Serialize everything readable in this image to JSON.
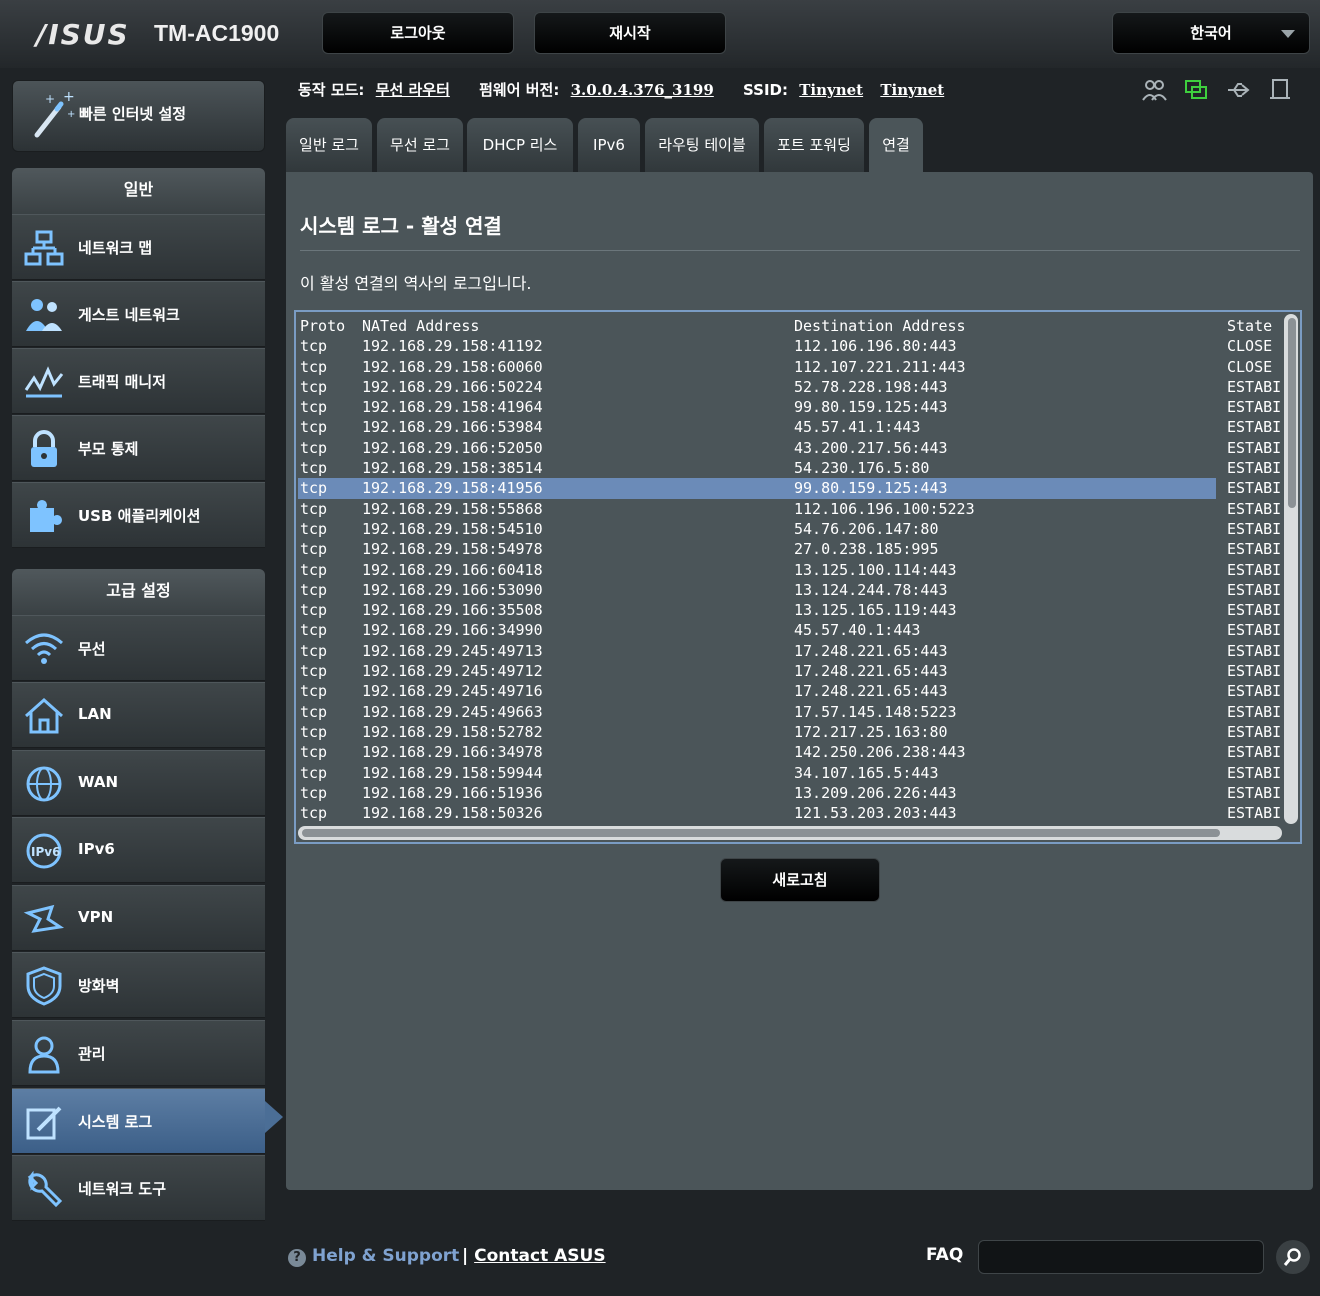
{
  "header": {
    "brand": "/ISUS",
    "model": "TM-AC1900",
    "logout_label": "로그아웃",
    "restart_label": "재시작",
    "language": "한국어"
  },
  "info": {
    "mode_label": "동작 모드:",
    "mode_value": "무선 라우터",
    "firmware_label": "펌웨어 버전:",
    "firmware_value": "3.0.0.4.376_3199",
    "ssid_label": "SSID:",
    "ssid_1": "Tinynet",
    "ssid_2": "Tinynet"
  },
  "sidebar": {
    "quick_setup": "빠른 인터넷 설정",
    "general_title": "일반",
    "general_items": [
      {
        "label": "네트워크 맵",
        "icon": "network-map-icon"
      },
      {
        "label": "게스트 네트워크",
        "icon": "guest-network-icon"
      },
      {
        "label": "트래픽 매니저",
        "icon": "traffic-manager-icon"
      },
      {
        "label": "부모 통제",
        "icon": "lock-icon"
      },
      {
        "label": "USB 애플리케이션",
        "icon": "puzzle-icon"
      }
    ],
    "advanced_title": "고급 설정",
    "advanced_items": [
      {
        "label": "무선",
        "icon": "wifi-icon"
      },
      {
        "label": "LAN",
        "icon": "home-icon"
      },
      {
        "label": "WAN",
        "icon": "globe-icon"
      },
      {
        "label": "IPv6",
        "icon": "ipv6-icon"
      },
      {
        "label": "VPN",
        "icon": "vpn-icon"
      },
      {
        "label": "방화벽",
        "icon": "shield-icon"
      },
      {
        "label": "관리",
        "icon": "admin-user-icon"
      },
      {
        "label": "시스템 로그",
        "icon": "system-log-icon"
      },
      {
        "label": "네트워크 도구",
        "icon": "network-tools-icon"
      }
    ]
  },
  "tabs": [
    "일반 로그",
    "무선 로그",
    "DHCP 리스",
    "IPv6",
    "라우팅 테이블",
    "포트 포워딩",
    "연결"
  ],
  "content": {
    "title": "시스템 로그 - 활성 연결",
    "description": "이 활성 연결의 역사의 로그입니다.",
    "columns": [
      "Proto",
      "NATed Address",
      "Destination Address",
      "State"
    ],
    "rows": [
      [
        "tcp",
        "192.168.29.158:41192",
        "112.106.196.80:443",
        "CLOSE"
      ],
      [
        "tcp",
        "192.168.29.158:60060",
        "112.107.221.211:443",
        "CLOSE"
      ],
      [
        "tcp",
        "192.168.29.166:50224",
        "52.78.228.198:443",
        "ESTABI"
      ],
      [
        "tcp",
        "192.168.29.158:41964",
        "99.80.159.125:443",
        "ESTABI"
      ],
      [
        "tcp",
        "192.168.29.166:53984",
        "45.57.41.1:443",
        "ESTABI"
      ],
      [
        "tcp",
        "192.168.29.166:52050",
        "43.200.217.56:443",
        "ESTABI"
      ],
      [
        "tcp",
        "192.168.29.158:38514",
        "54.230.176.5:80",
        "ESTABI"
      ],
      [
        "tcp",
        "192.168.29.158:41956",
        "99.80.159.125:443",
        "ESTABI"
      ],
      [
        "tcp",
        "192.168.29.158:55868",
        "112.106.196.100:5223",
        "ESTABI"
      ],
      [
        "tcp",
        "192.168.29.158:54510",
        "54.76.206.147:80",
        "ESTABI"
      ],
      [
        "tcp",
        "192.168.29.158:54978",
        "27.0.238.185:995",
        "ESTABI"
      ],
      [
        "tcp",
        "192.168.29.166:60418",
        "13.125.100.114:443",
        "ESTABI"
      ],
      [
        "tcp",
        "192.168.29.166:53090",
        "13.124.244.78:443",
        "ESTABI"
      ],
      [
        "tcp",
        "192.168.29.166:35508",
        "13.125.165.119:443",
        "ESTABI"
      ],
      [
        "tcp",
        "192.168.29.166:34990",
        "45.57.40.1:443",
        "ESTABI"
      ],
      [
        "tcp",
        "192.168.29.245:49713",
        "17.248.221.65:443",
        "ESTABI"
      ],
      [
        "tcp",
        "192.168.29.245:49712",
        "17.248.221.65:443",
        "ESTABI"
      ],
      [
        "tcp",
        "192.168.29.245:49716",
        "17.248.221.65:443",
        "ESTABI"
      ],
      [
        "tcp",
        "192.168.29.245:49663",
        "17.57.145.148:5223",
        "ESTABI"
      ],
      [
        "tcp",
        "192.168.29.158:52782",
        "172.217.25.163:80",
        "ESTABI"
      ],
      [
        "tcp",
        "192.168.29.166:34978",
        "142.250.206.238:443",
        "ESTABI"
      ],
      [
        "tcp",
        "192.168.29.158:59944",
        "34.107.165.5:443",
        "ESTABI"
      ],
      [
        "tcp",
        "192.168.29.166:51936",
        "13.209.206.226:443",
        "ESTABI"
      ],
      [
        "tcp",
        "192.168.29.158:50326",
        "121.53.203.203:443",
        "ESTABI"
      ]
    ],
    "selected_row": 7,
    "refresh_label": "새로고침"
  },
  "footer": {
    "help_label": "Help & Support",
    "separator": "|",
    "contact_label": "Contact ASUS",
    "faq_label": "FAQ",
    "faq_placeholder": ""
  },
  "colors": {
    "accent": "#6b8bb8",
    "active_nav": "#4b6e96",
    "content_bg": "#4b5559",
    "link": "#7fa2d0"
  }
}
